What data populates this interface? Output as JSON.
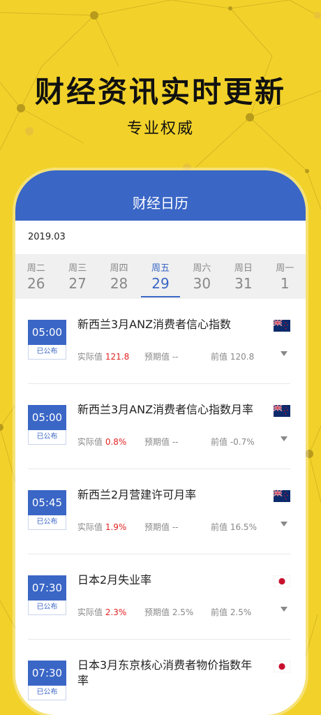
{
  "hero": {
    "title": "财经资讯实时更新",
    "subtitle": "专业权威"
  },
  "app": {
    "header_title": "财经日历",
    "month": "2019.03",
    "week": [
      {
        "label": "周二",
        "date": "26"
      },
      {
        "label": "周三",
        "date": "27"
      },
      {
        "label": "周四",
        "date": "28"
      },
      {
        "label": "周五",
        "date": "29",
        "active": true
      },
      {
        "label": "周六",
        "date": "30"
      },
      {
        "label": "周日",
        "date": "31"
      },
      {
        "label": "周一",
        "date": "1"
      }
    ],
    "labels": {
      "actual": "实际值",
      "forecast": "预期值",
      "previous": "前值"
    },
    "events": [
      {
        "time": "05:00",
        "status": "已公布",
        "title": "新西兰3月ANZ消费者信心指数",
        "actual": "121.8",
        "forecast": "--",
        "previous": "120.8",
        "flag": "nz-flag"
      },
      {
        "time": "05:00",
        "status": "已公布",
        "title": "新西兰3月ANZ消费者信心指数月率",
        "actual": "0.8%",
        "forecast": "--",
        "previous": "-0.7%",
        "flag": "nz-flag"
      },
      {
        "time": "05:45",
        "status": "已公布",
        "title": "新西兰2月营建许可月率",
        "actual": "1.9%",
        "forecast": "--",
        "previous": "16.5%",
        "flag": "nz-flag"
      },
      {
        "time": "07:30",
        "status": "已公布",
        "title": "日本2月失业率",
        "actual": "2.3%",
        "forecast": "2.5%",
        "previous": "2.5%",
        "flag": "jp-flag"
      },
      {
        "time": "07:30",
        "status": "已公布",
        "title": "日本3月东京核心消费者物价指数年率",
        "flag": "jp-flag"
      }
    ]
  },
  "colors": {
    "background": "#f2d22a",
    "accent": "#3a66c6",
    "actual": "#e02222"
  }
}
